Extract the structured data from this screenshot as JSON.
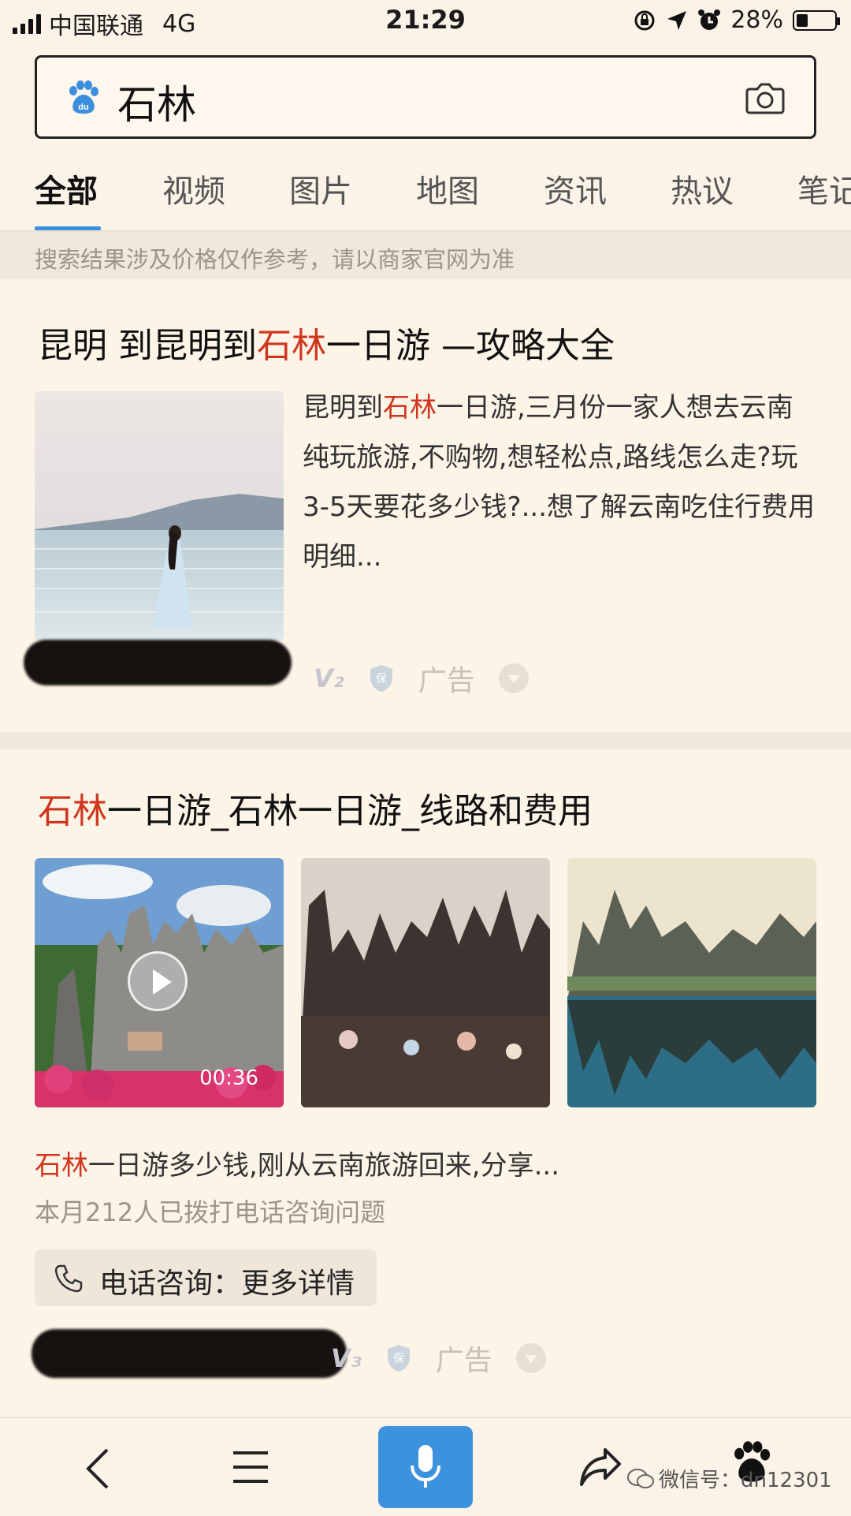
{
  "status_bar": {
    "carrier": "中国联通",
    "network": "4G",
    "time": "21:29",
    "battery": "28%",
    "battery_level": 0.28
  },
  "search": {
    "query": "石林",
    "logo_icon": "baidu-paw-icon",
    "camera_icon": "camera-icon"
  },
  "tabs": [
    "全部",
    "视频",
    "图片",
    "地图",
    "资讯",
    "热议",
    "笔记"
  ],
  "notice": "搜索结果涉及价格仅作参考，请以商家官网为准",
  "result1": {
    "title_pre": "昆明 到昆明到",
    "title_hl": "石林",
    "title_post": "一日游 —攻略大全",
    "desc_pre": "昆明到",
    "desc_hl": "石林",
    "desc_post": "一日游,三月份一家人想去云南纯玩旅游,不购物,想轻松点,路线怎么走?玩3-5天要花多少钱?...想了解云南吃住行费用明细...",
    "badge_v": "V₂",
    "badge_bao": "保",
    "ad_label": "广告"
  },
  "result2": {
    "title_hl": "石林",
    "title_post": "一日游_石林一日游_线路和费用",
    "video_duration": "00:36",
    "snippet_hl": "石林",
    "snippet_post": "一日游多少钱,刚从云南旅游回来,分享...",
    "call_count": "本月212人已拨打电话咨询问题",
    "call_button": "电话咨询：更多详情",
    "badge_v": "V₃",
    "badge_bao": "保",
    "ad_label": "广告"
  },
  "bottom_nav": {
    "watermark": "微信号：dn12301"
  },
  "colors": {
    "accent": "#3a8fe0",
    "highlight": "#d0361e",
    "background": "#fbf3e8"
  }
}
